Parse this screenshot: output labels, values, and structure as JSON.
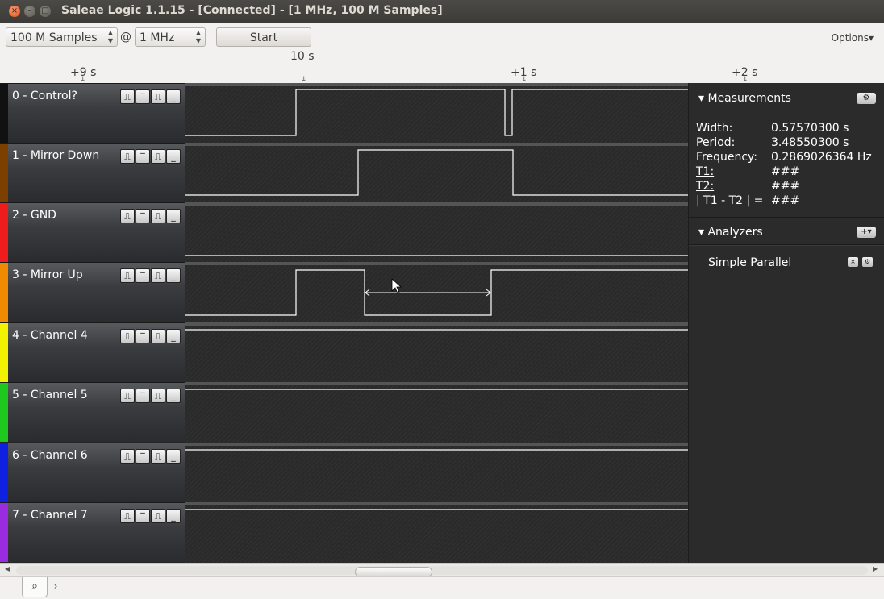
{
  "window": {
    "title": "Saleae Logic 1.1.15 - [Connected] - [1 MHz, 100 M Samples]",
    "close": "×",
    "minimize": "–",
    "maximize": "□"
  },
  "toolbar": {
    "samples": "100 M Samples",
    "at": "@",
    "rate": "1 MHz",
    "start": "Start",
    "options": "Options▾"
  },
  "timeline": {
    "center": "10 s",
    "labels": [
      "+9 s",
      "+1 s",
      "+2 s"
    ]
  },
  "channels": [
    {
      "name": "0 - Control?",
      "color": "#111111"
    },
    {
      "name": "1 - Mirror Down",
      "color": "#7b3f00"
    },
    {
      "name": "2 - GND",
      "color": "#ee1c1c"
    },
    {
      "name": "3 - Mirror Up",
      "color": "#f08a00"
    },
    {
      "name": "4 - Channel 4",
      "color": "#f2f200"
    },
    {
      "name": "5 - Channel 5",
      "color": "#1ec81e"
    },
    {
      "name": "6 - Channel 6",
      "color": "#1020e0"
    },
    {
      "name": "7 - Channel 7",
      "color": "#9b2be0"
    }
  ],
  "trigger_glyphs": [
    "⎍",
    "‾",
    "⎍",
    "_"
  ],
  "measurements": {
    "title": "Measurements",
    "rows": [
      {
        "key": "Width:",
        "value": "0.57570300 s"
      },
      {
        "key": "Period:",
        "value": "3.48550300 s"
      },
      {
        "key": "Frequency:",
        "value": "0.2869026364 Hz"
      },
      {
        "key": "T1:",
        "value": "###"
      },
      {
        "key": "T2:",
        "value": "###"
      },
      {
        "key": "| T1 - T2 | =",
        "value": "###"
      }
    ]
  },
  "analyzers": {
    "title": "Analyzers",
    "items": [
      {
        "name": "Simple Parallel"
      }
    ]
  },
  "icons": {
    "gear": "⚙",
    "plus": "+▾",
    "close": "×",
    "search": "⌕",
    "chevron": "›"
  }
}
